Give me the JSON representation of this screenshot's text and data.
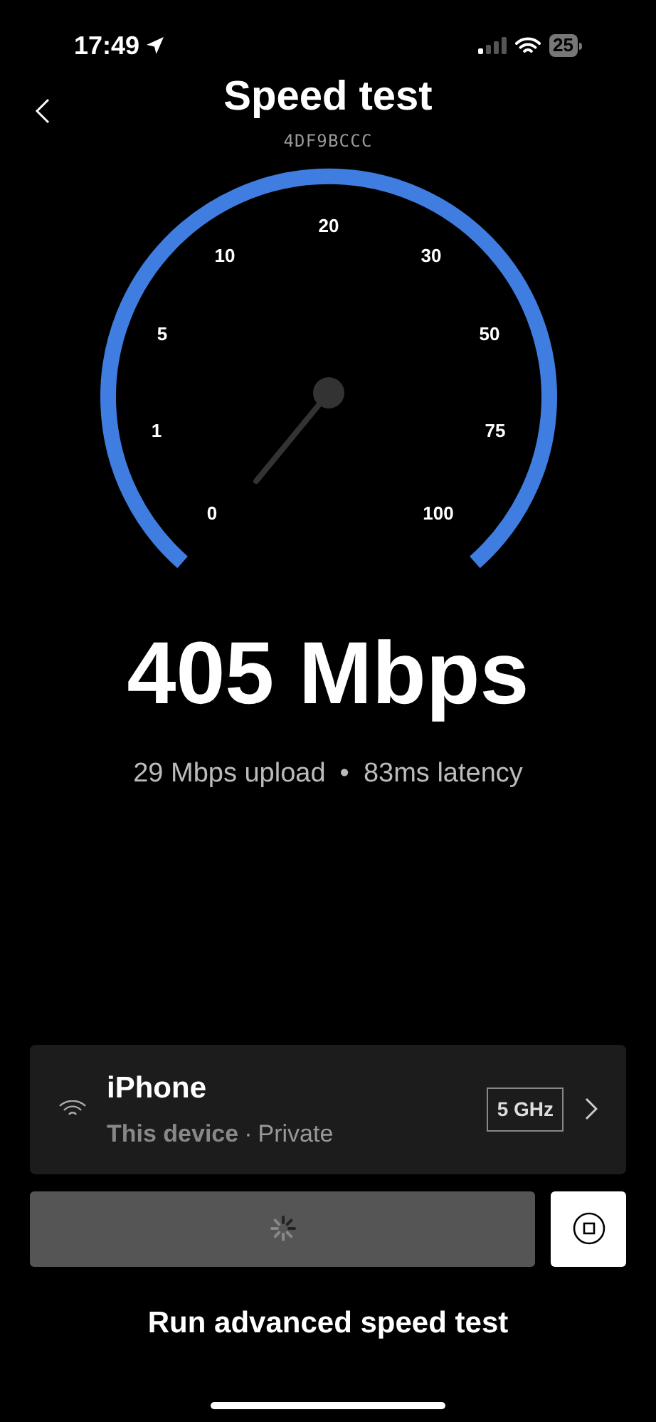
{
  "status_bar": {
    "time": "17:49",
    "battery": "25"
  },
  "header": {
    "title": "Speed test",
    "subtitle": "4DF9BCCC"
  },
  "gauge": {
    "ticks": [
      "0",
      "1",
      "5",
      "10",
      "20",
      "30",
      "50",
      "75",
      "100"
    ]
  },
  "result": {
    "download": "405 Mbps",
    "upload": "29 Mbps upload",
    "separator": "•",
    "latency": "83ms latency"
  },
  "device": {
    "name": "iPhone",
    "label": "This device",
    "separator": "·",
    "privacy": "Private",
    "band": "5 GHz"
  },
  "advanced_link": "Run advanced speed test"
}
